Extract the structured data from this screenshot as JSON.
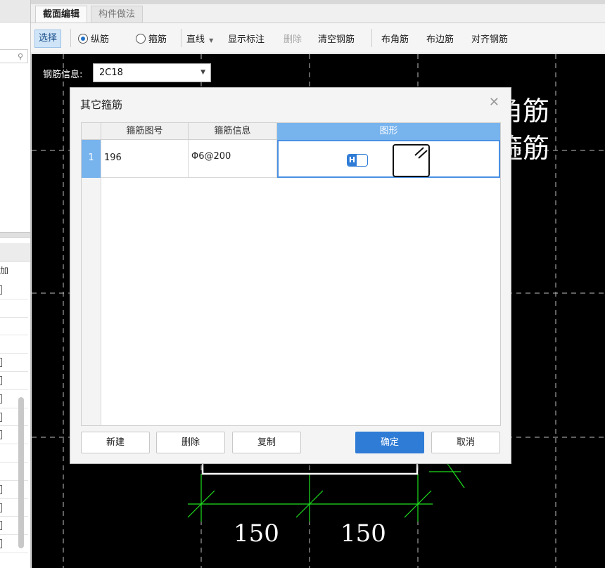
{
  "tabs": [
    {
      "label": "截面编辑",
      "active": true
    },
    {
      "label": "构件做法",
      "active": false
    }
  ],
  "toolbar": {
    "select_label": "选择",
    "radio_longitudinal": "纵筋",
    "radio_stirrup": "箍筋",
    "line_dropdown": "直线",
    "show_annotation": "显示标注",
    "delete": "删除",
    "clear_rebar": "清空钢筋",
    "corner_rebar": "布角筋",
    "side_rebar": "布边筋",
    "align_rebar": "对齐钢筋"
  },
  "left_panel": {
    "column_head": "加",
    "search_icon": "search-icon"
  },
  "canvas": {
    "rebar_info_label": "钢筋信息:",
    "rebar_info_value": "2C18",
    "partial_text_1": "角筋",
    "partial_text_2": "箍筋",
    "dim_left": "150",
    "dim_right": "150",
    "colors": {
      "background": "#000000",
      "dim_lines": "#1fe01f",
      "dashed_grid": "#bfbfbf"
    }
  },
  "dialog": {
    "title": "其它箍筋",
    "close_icon": "close-icon",
    "columns": [
      "箍筋图号",
      "箍筋信息",
      "图形"
    ],
    "rows": [
      {
        "index": "1",
        "figure_no": "196",
        "info": "Φ6@200",
        "h_icon": "H"
      }
    ],
    "buttons": {
      "new": "新建",
      "delete": "删除",
      "copy": "复制",
      "ok": "确定",
      "cancel": "取消"
    },
    "colors": {
      "selection": "#77b3ed",
      "primary_button": "#2f7cd6"
    }
  }
}
